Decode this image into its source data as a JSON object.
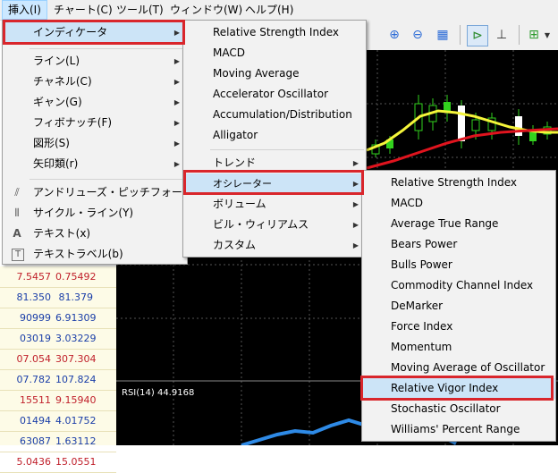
{
  "menubar": {
    "items": [
      {
        "label": "挿入(I)"
      },
      {
        "label": "チャート(C)"
      },
      {
        "label": "ツール(T)"
      },
      {
        "label": "ウィンドウ(W)"
      },
      {
        "label": "ヘルプ(H)"
      }
    ]
  },
  "insert_menu": {
    "items": [
      {
        "label": "インディケータ"
      },
      {
        "label": "ライン(L)"
      },
      {
        "label": "チャネル(C)"
      },
      {
        "label": "ギャン(G)"
      },
      {
        "label": "フィボナッチ(F)"
      },
      {
        "label": "図形(S)"
      },
      {
        "label": "矢印類(r)"
      },
      {
        "label": "アンドリューズ・ピッチフォーク(A)"
      },
      {
        "label": "サイクル・ライン(Y)"
      },
      {
        "label": "テキスト(x)"
      },
      {
        "label": "テキストラベル(b)"
      }
    ]
  },
  "indicators_menu": {
    "items": [
      {
        "label": "Relative Strength Index"
      },
      {
        "label": "MACD"
      },
      {
        "label": "Moving Average"
      },
      {
        "label": "Accelerator Oscillator"
      },
      {
        "label": "Accumulation/Distribution"
      },
      {
        "label": "Alligator"
      },
      {
        "label": "トレンド"
      },
      {
        "label": "オシレーター"
      },
      {
        "label": "ボリューム"
      },
      {
        "label": "ビル・ウィリアムス"
      },
      {
        "label": "カスタム"
      }
    ]
  },
  "oscillators_menu": {
    "items": [
      {
        "label": "Relative Strength Index"
      },
      {
        "label": "MACD"
      },
      {
        "label": "Average True Range"
      },
      {
        "label": "Bears Power"
      },
      {
        "label": "Bulls Power"
      },
      {
        "label": "Commodity Channel Index"
      },
      {
        "label": "DeMarker"
      },
      {
        "label": "Force Index"
      },
      {
        "label": "Momentum"
      },
      {
        "label": "Moving Average of Oscillator"
      },
      {
        "label": "Relative Vigor Index"
      },
      {
        "label": "Stochastic Oscillator"
      },
      {
        "label": "Williams' Percent Range"
      }
    ]
  },
  "price_table": {
    "rows": [
      {
        "bid": "7.5457",
        "ask": "0.75492",
        "color": "#c0202b"
      },
      {
        "bid": "81.350",
        "ask": "81.379",
        "color": "#1a3ea8"
      },
      {
        "bid": "90999",
        "ask": "6.91309",
        "color": "#1a3ea8"
      },
      {
        "bid": "03019",
        "ask": "3.03229",
        "color": "#1a3ea8"
      },
      {
        "bid": "07.054",
        "ask": "307.304",
        "color": "#c0202b"
      },
      {
        "bid": "07.782",
        "ask": "107.824",
        "color": "#1a3ea8"
      },
      {
        "bid": "15511",
        "ask": "9.15940",
        "color": "#c0202b"
      },
      {
        "bid": "01494",
        "ask": "4.01752",
        "color": "#1a3ea8"
      },
      {
        "bid": "63087",
        "ask": "1.63112",
        "color": "#1a3ea8"
      },
      {
        "bid": "5.0436",
        "ask": "15.0551",
        "color": "#c0202b"
      }
    ]
  },
  "chart": {
    "rsi_label": "RSI(14) 44.9168",
    "ma_yellow_color": "#f5f53a",
    "ma_red_color": "#e0141e",
    "rsi_line_color": "#2e8ae6",
    "candle_color": "#32d21e"
  },
  "toolbar": {
    "icons": [
      "zoom-in-icon",
      "zoom-out-icon",
      "tile-windows-icon",
      "chart-shift-icon",
      "autoscroll-icon",
      "add-indicator-icon"
    ]
  }
}
